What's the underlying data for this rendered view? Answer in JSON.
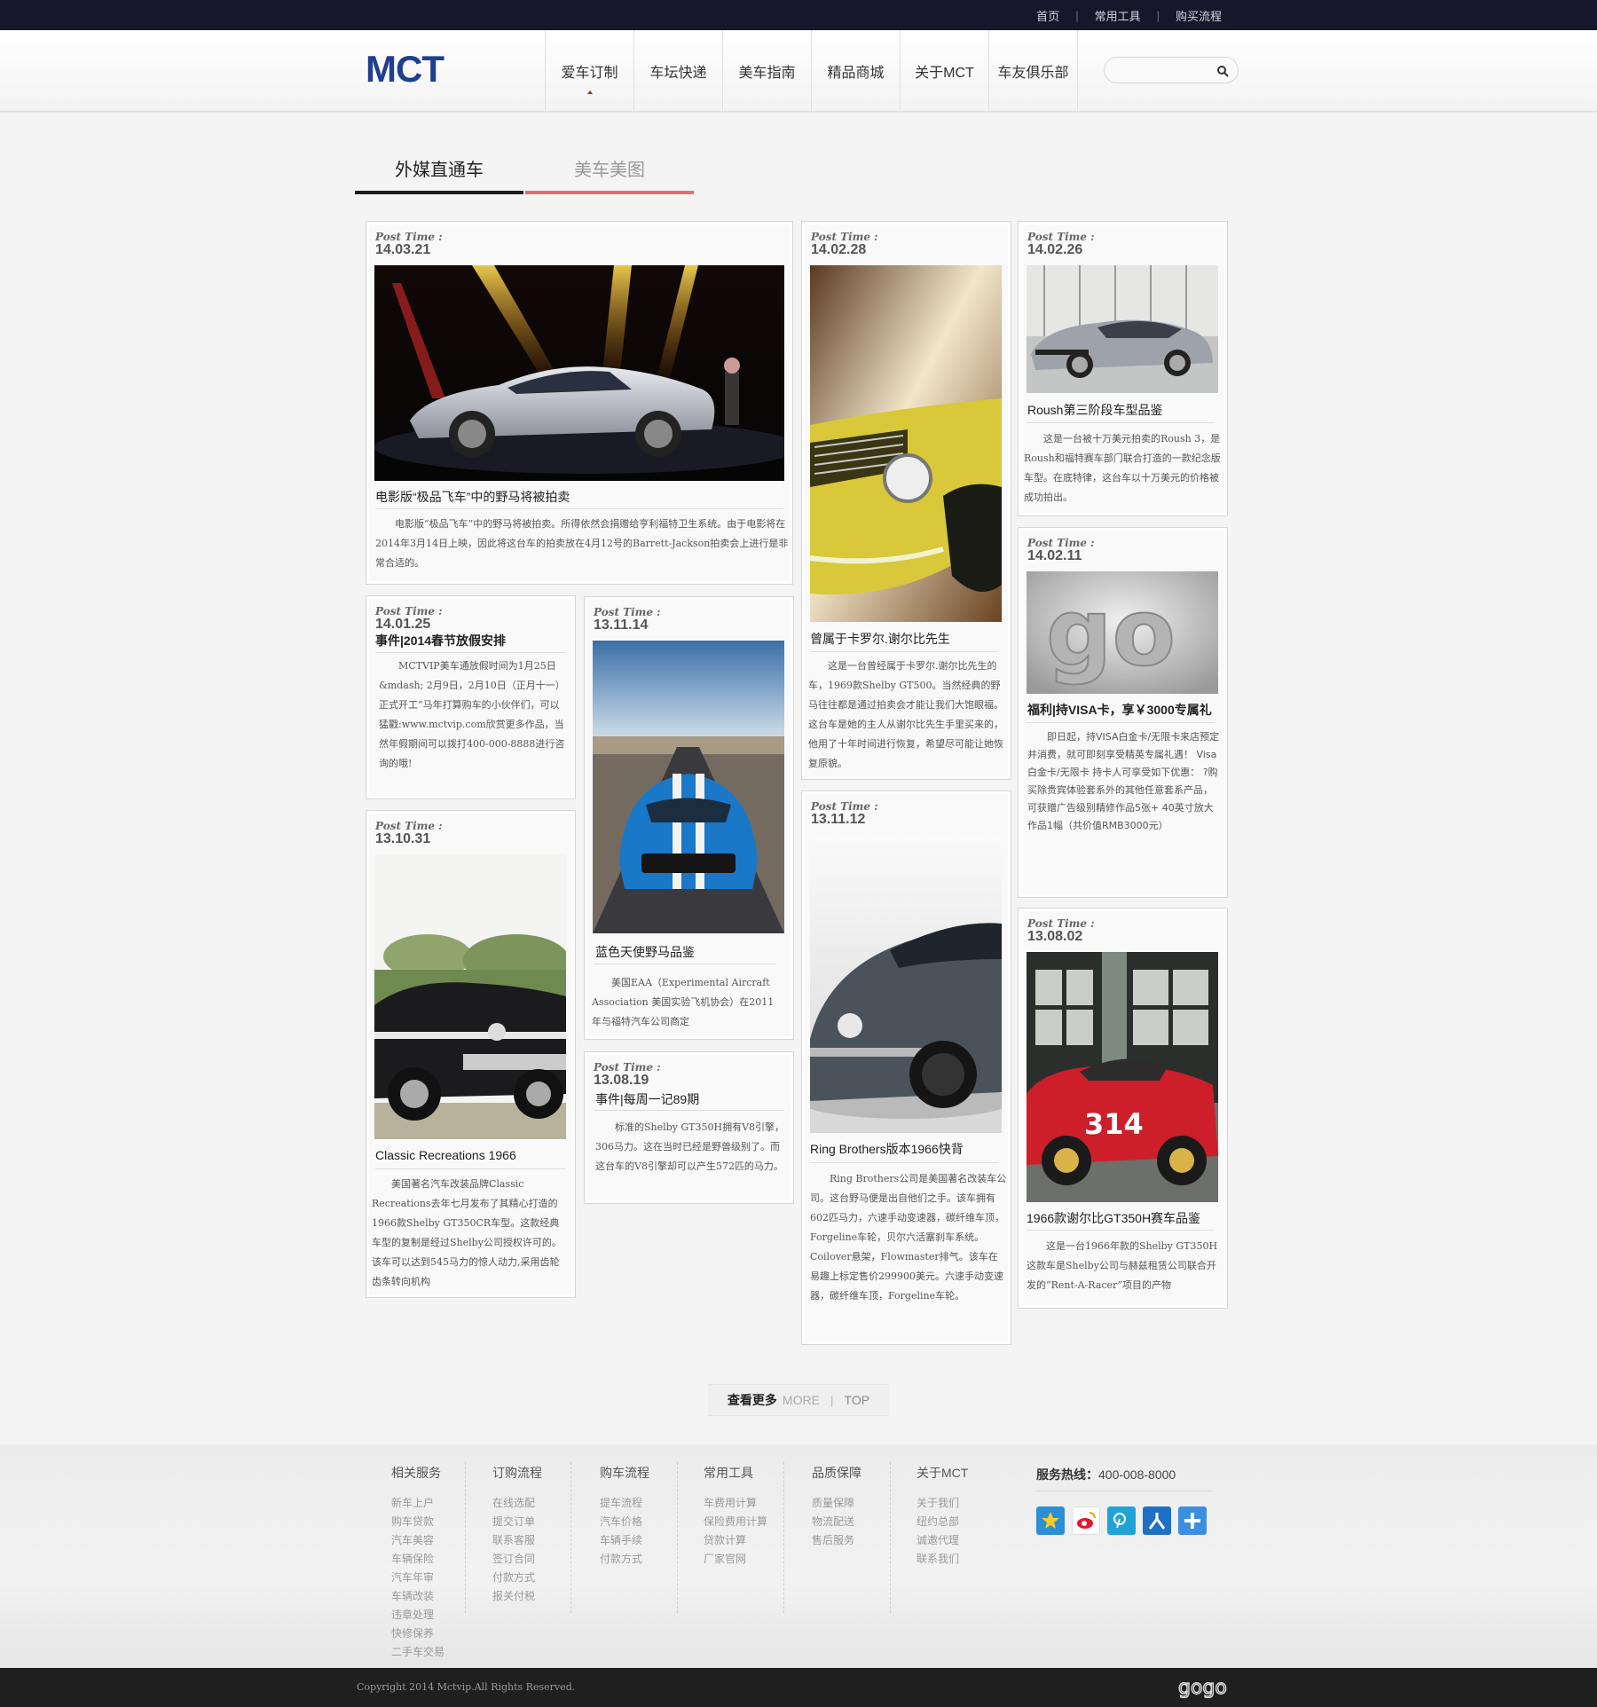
{
  "topbar": {
    "links": [
      "首页",
      "常用工具",
      "购买流程"
    ]
  },
  "header": {
    "logo": "MCT",
    "nav": [
      "爱车订制",
      "车坛快递",
      "美车指南",
      "精品商城",
      "关于MCT",
      "车友俱乐部"
    ],
    "active_nav": "爱车订制",
    "search_placeholder": ""
  },
  "tabs": [
    "外媒直通车",
    "美车美图"
  ],
  "post_time_label": "Post Time :",
  "cards": [
    {
      "date": "14.03.21",
      "title": "电影版“极品飞车”中的野马将被拍卖",
      "desc": "电影版“极品飞车”中的野马将被拍卖。所得依然会捐赠给亨利福特卫生系统。由于电影将在2014年3月14日上映，因此将这台车的拍卖放在4月12号的Barrett-Jackson拍卖会上进行是非常合适的。"
    },
    {
      "date": "14.01.25",
      "title": "事件|2014春节放假安排",
      "desc": "MCTVIP美车通放假时间为1月25日&mdash; 2月9日，2月10日（正月十一）正式开工“马年打算购车的小伙伴们，可以猛戳:www.mctvip.com欣赏更多作品，当然年假期间可以拨打400-000-8888进行咨询的哦!"
    },
    {
      "date": "13.10.31",
      "title": "Classic Recreations 1966",
      "desc": "美国著名汽车改装品牌Classic Recreations去年七月发布了其精心打造的1966款Shelby GT350CR车型。这款经典车型的复制是经过Shelby公司授权许可的。该车可以达到545马力的惊人动力,采用齿轮齿条转向机构"
    },
    {
      "date": "13.11.14",
      "title": "蓝色天使野马品鉴",
      "desc": "美国EAA（Experimental Aircraft Association 美国实验飞机协会）在2011年与福特汽车公司商定"
    },
    {
      "date": "13.08.19",
      "title": "事件|每周一记89期",
      "desc": "标准的Shelby GT350H拥有V8引擎，306马力。这在当时已经是野兽级别了。而这台车的V8引擎却可以产生572匹的马力。"
    },
    {
      "date": "14.02.28",
      "title": "曾属于卡罗尔.谢尔比先生",
      "desc": "这是一台曾经属于卡罗尔.谢尔比先生的车，1969款Shelby GT500。当然经典的野马往往都是通过拍卖会才能让我们大饱眼福。这台车是她的主人从谢尔比先生手里买来的，他用了十年时间进行恢复，希望尽可能让她恢复原貌。"
    },
    {
      "date": "13.11.12",
      "title": "Ring Brothers版本1966快背",
      "desc": "Ring Brothers公司是美国著名改装车公司。这台野马便是出自他们之手。该车拥有602匹马力，六速手动变速器，碳纤维车顶，Forgeline车轮，贝尔六活塞刹车系统。Coilover悬架，Flowmaster排气。该车在易趣上标定售价299900美元。六速手动变速器，碳纤维车顶，Forgeline车轮。"
    },
    {
      "date": "14.02.26",
      "title": "Roush第三阶段车型品鉴",
      "desc": "这是一台被十万美元拍卖的Roush 3，是Roush和福特赛车部门联合打造的一款纪念版车型。在底特律，这台车以十万美元的价格被成功拍出。"
    },
    {
      "date": "14.02.11",
      "title": "福利|持VISA卡，享￥3000专属礼",
      "desc": "即日起，持VISA白金卡/无限卡来店预定并消费，就可即刻享受精英专属礼遇！ Visa白金卡/无限卡 持卡人可享受如下优惠： ?购买除贵宾体验套系外的其他任意套系产品，可获赠广告级别精修作品5张+ 40英寸放大作品1幅（共价值RMB3000元）"
    },
    {
      "date": "13.08.02",
      "title": "1966款谢尔比GT350H赛车品鉴",
      "desc": "这是一台1966年款的Shelby GT350H这款车是Shelby公司与赫兹租赁公司联合开发的“Rent-A-Racer”项目的产物"
    }
  ],
  "more": {
    "label": "查看更多",
    "en": "MORE",
    "top": "TOP"
  },
  "footer": {
    "columns": [
      {
        "head": "相关服务",
        "items": [
          "新车上户",
          "购车贷款",
          "汽车美容",
          "车辆保险",
          "汽车年审",
          "车辆改装",
          "违章处理",
          "快修保养",
          "二手车交易"
        ]
      },
      {
        "head": "订购流程",
        "items": [
          "在线选配",
          "提交订单",
          "联系客服",
          "签订合同",
          "付款方式",
          "报关付税"
        ]
      },
      {
        "head": "购车流程",
        "items": [
          "提车流程",
          "汽车价格",
          "车辆手续",
          "付款方式"
        ]
      },
      {
        "head": "常用工具",
        "items": [
          "车费用计算",
          "保险费用计算",
          "贷款计算",
          "厂家官网"
        ]
      },
      {
        "head": "品质保障",
        "items": [
          "质量保障",
          "物流配送",
          "售后服务"
        ]
      },
      {
        "head": "关于MCT",
        "items": [
          "关于我们",
          "纽约总部",
          "诚邀代理",
          "联系我们"
        ]
      }
    ],
    "hotline_label": "服务热线：",
    "hotline": "400-008-8000",
    "socials": [
      "qzone-icon",
      "weibo-icon",
      "tencent-weibo-icon",
      "renren-icon",
      "share-plus-icon"
    ],
    "copyright": "Copyright 2014 Mctvip.All Rights Reserved.",
    "bottom_logo": "gogo"
  },
  "colors": {
    "topbar": "#16172a",
    "logo": "#1f3f8f",
    "accent_red": "#c41a1a",
    "tab_active": "#1b1b1b",
    "tab_inactive": "#e07070"
  }
}
